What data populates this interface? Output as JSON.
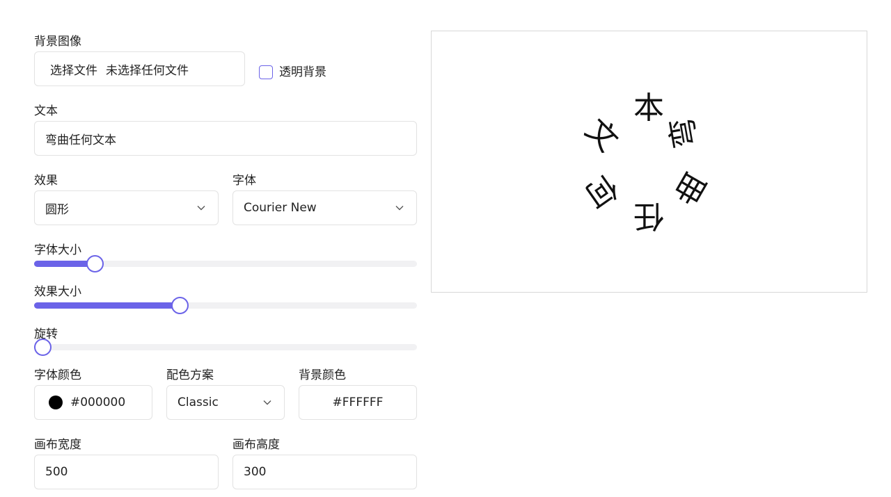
{
  "background_image": {
    "label": "背景图像",
    "file_button": "选择文件",
    "file_status": "未选择任何文件",
    "transparent_label": "透明背景",
    "transparent_checked": false
  },
  "text": {
    "label": "文本",
    "value": "弯曲任何文本"
  },
  "effect": {
    "label": "效果",
    "value": "圆形"
  },
  "font": {
    "label": "字体",
    "value": "Courier New"
  },
  "font_size": {
    "label": "字体大小",
    "level": 0.143
  },
  "effect_size": {
    "label": "效果大小",
    "level": 0.375
  },
  "rotation": {
    "label": "旋转",
    "level": 0
  },
  "font_color": {
    "label": "字体颜色",
    "value": "#000000",
    "swatch": "#000000"
  },
  "color_scheme": {
    "label": "配色方案",
    "value": "Classic"
  },
  "background_color": {
    "label": "背景颜色",
    "value": "#FFFFFF"
  },
  "canvas_width": {
    "label": "画布宽度",
    "value": "500"
  },
  "canvas_height": {
    "label": "画布高度",
    "value": "300"
  },
  "preview": {
    "glyphs": [
      "弯",
      "曲",
      "任",
      "何",
      "文",
      "本"
    ]
  },
  "colors": {
    "accent": "#6b63e8"
  },
  "icons": {
    "dropdown": "chevron-down-icon"
  }
}
